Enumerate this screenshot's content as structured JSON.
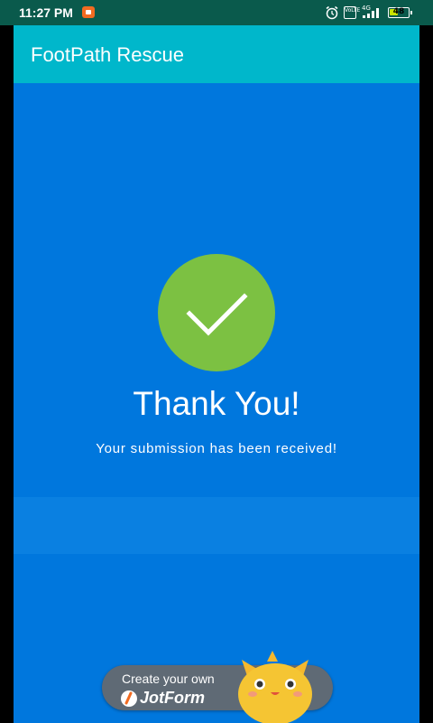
{
  "status_bar": {
    "time": "11:27 PM",
    "volte": "VoLTE",
    "network": "4G",
    "battery": "48",
    "battery_level": 0.48,
    "icons": [
      "screen-record-icon",
      "alarm-icon",
      "volte-icon",
      "signal-icon",
      "battery-icon"
    ]
  },
  "app_bar": {
    "title": "FootPath Rescue"
  },
  "confirmation": {
    "title": "Thank You!",
    "message": "Your submission has been received!"
  },
  "badge": {
    "line1": "Create your own",
    "brand": "JotForm"
  },
  "colors": {
    "status_bar": "#0a5a4c",
    "app_bar": "#00b7cb",
    "background": "#0077dd",
    "check_circle": "#7cc142",
    "badge": "#5f6a75"
  }
}
